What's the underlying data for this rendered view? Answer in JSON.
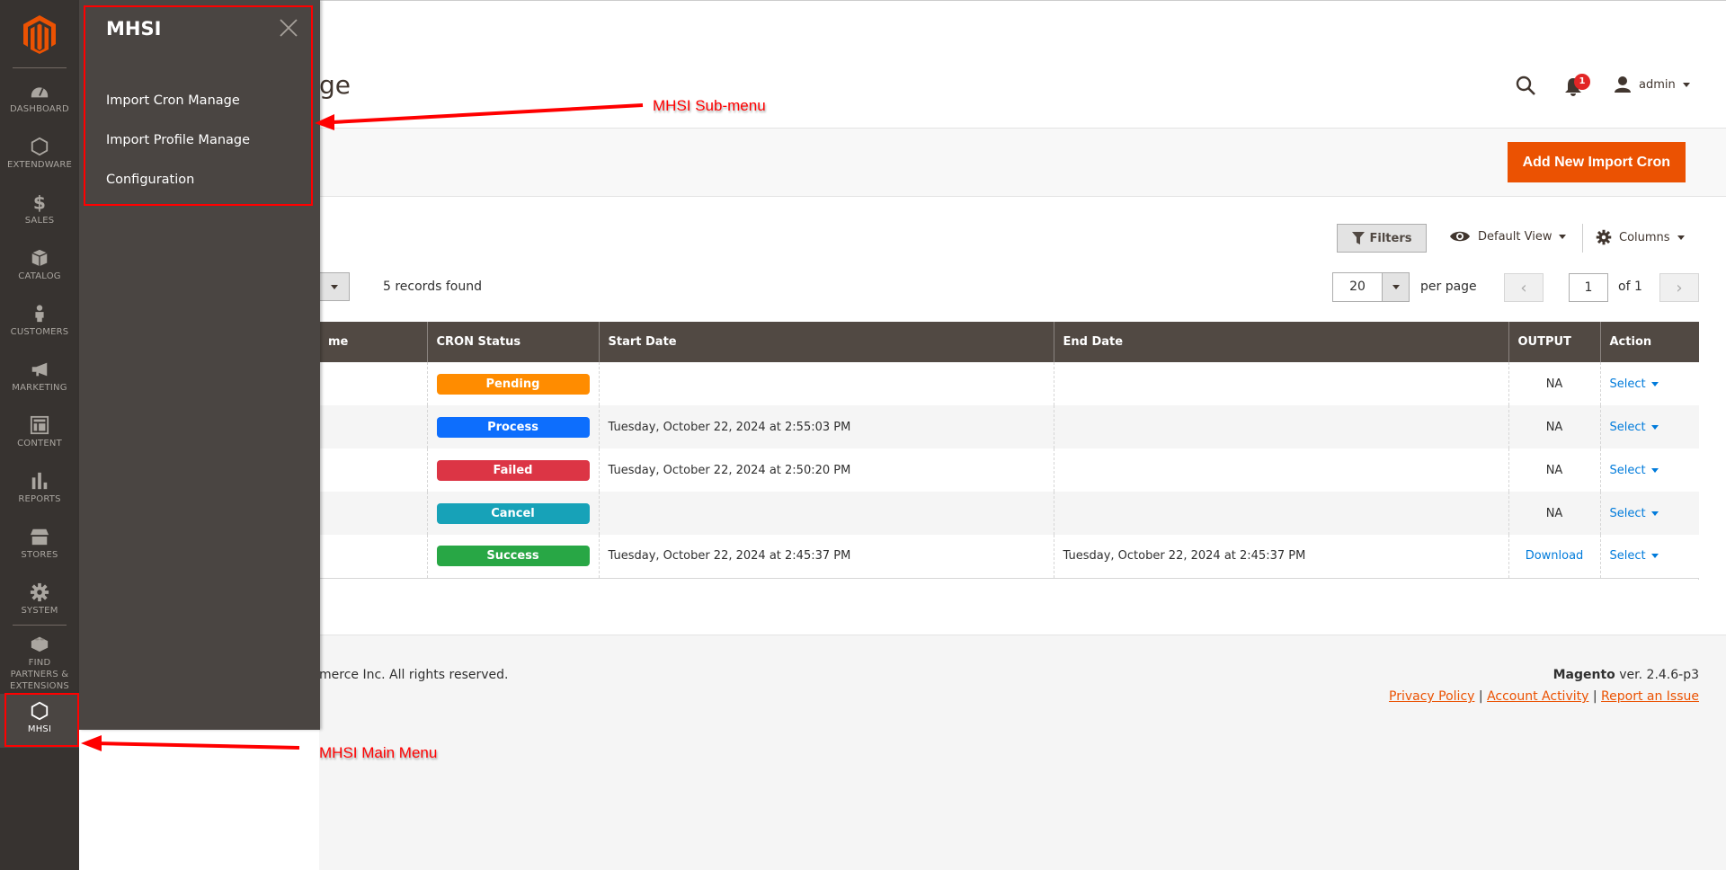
{
  "header": {
    "page_title_visible": "ge",
    "admin_user": "admin",
    "notification_count": "1",
    "add_button": "Add New Import Cron"
  },
  "sidebar": {
    "items": [
      {
        "label": "DASHBOARD",
        "icon": "dashboard-icon"
      },
      {
        "label": "EXTENDWARE",
        "icon": "hexagon-icon"
      },
      {
        "label": "SALES",
        "icon": "dollar-icon"
      },
      {
        "label": "CATALOG",
        "icon": "box-icon"
      },
      {
        "label": "CUSTOMERS",
        "icon": "person-icon"
      },
      {
        "label": "MARKETING",
        "icon": "megaphone-icon"
      },
      {
        "label": "CONTENT",
        "icon": "layout-icon"
      },
      {
        "label": "REPORTS",
        "icon": "bar-chart-icon"
      },
      {
        "label": "STORES",
        "icon": "storefront-icon"
      },
      {
        "label": "SYSTEM",
        "icon": "gear-icon"
      },
      {
        "label": "FIND PARTNERS & EXTENSIONS",
        "icon": "lego-brick-icon"
      },
      {
        "label": "MHSI",
        "icon": "hexagon-icon"
      }
    ]
  },
  "flyout": {
    "title": "MHSI",
    "items": [
      "Import Cron Manage",
      "Import Profile Manage",
      "Configuration"
    ]
  },
  "annotations": {
    "submenu": "MHSI Sub-menu",
    "mainmenu": "MHSI Main Menu"
  },
  "toolbar": {
    "filters": "Filters",
    "view": "Default View",
    "columns": "Columns",
    "records": "5 records found",
    "per_page_value": "20",
    "per_page_label": "per page",
    "page_current": "1",
    "page_of": "of 1"
  },
  "grid": {
    "columns": [
      "me",
      "CRON Status",
      "Start Date",
      "End Date",
      "OUTPUT",
      "Action"
    ],
    "rows": [
      {
        "status": "Pending",
        "status_color": "#ff8c00",
        "start": "",
        "end": "",
        "output": "NA",
        "action": "Select"
      },
      {
        "status": "Process",
        "status_color": "#0d6efd",
        "start": "Tuesday, October 22, 2024 at 2:55:03 PM",
        "end": "",
        "output": "NA",
        "action": "Select"
      },
      {
        "status": "Failed",
        "status_color": "#dc3545",
        "start": "Tuesday, October 22, 2024 at 2:50:20 PM",
        "end": "",
        "output": "NA",
        "action": "Select"
      },
      {
        "status": "Cancel",
        "status_color": "#17a2b8",
        "start": "",
        "end": "",
        "output": "NA",
        "action": "Select"
      },
      {
        "status": "Success",
        "status_color": "#28a745",
        "start": "Tuesday, October 22, 2024 at 2:45:37 PM",
        "end": "Tuesday, October 22, 2024 at 2:45:37 PM",
        "output": "Download",
        "action": "Select"
      }
    ]
  },
  "footer": {
    "copyright": "merce Inc. All rights reserved.",
    "brand": "Magento",
    "version": " ver. 2.4.6-p3",
    "links": [
      "Privacy Policy",
      "Account Activity",
      "Report an Issue"
    ]
  },
  "colors": {
    "accent": "#eb5202",
    "sidebar": "#373330",
    "flyout": "#4a4542",
    "table_header": "#514943",
    "link": "#007bdb"
  }
}
